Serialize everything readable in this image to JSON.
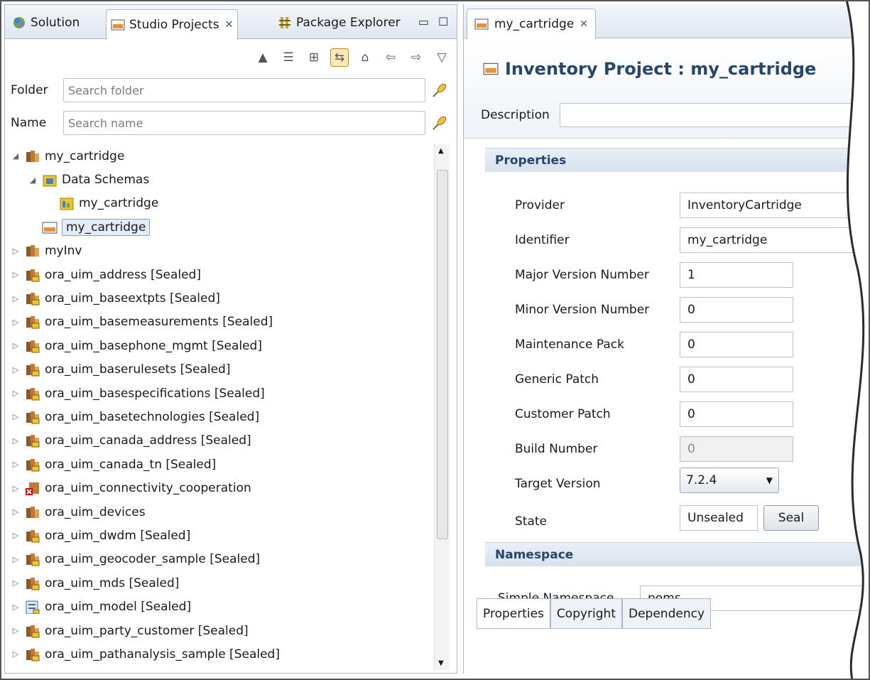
{
  "left_panel": {
    "tabs": [
      {
        "label": "Solution"
      },
      {
        "label": "Studio Projects"
      },
      {
        "label": "Package Explorer"
      }
    ],
    "folder_filter": {
      "label": "Folder",
      "placeholder": "Search folder"
    },
    "name_filter": {
      "label": "Name",
      "placeholder": "Search name"
    },
    "tree": [
      {
        "label": "my_cartridge",
        "level": 0,
        "expanded": true,
        "icon": "cartridge-icon"
      },
      {
        "label": "Data Schemas",
        "level": 1,
        "expanded": true,
        "icon": "data-schemas-folder-icon"
      },
      {
        "label": "my_cartridge",
        "level": 2,
        "icon": "data-schema-icon"
      },
      {
        "label": "my_cartridge",
        "level": 1,
        "icon": "inventory-project-icon",
        "selected": true
      },
      {
        "label": "myInv",
        "level": 0,
        "icon": "cartridge-icon"
      },
      {
        "label": "ora_uim_address [Sealed]",
        "level": 0,
        "icon": "sealed-cartridge-icon"
      },
      {
        "label": "ora_uim_baseextpts [Sealed]",
        "level": 0,
        "icon": "sealed-cartridge-icon"
      },
      {
        "label": "ora_uim_basemeasurements [Sealed]",
        "level": 0,
        "icon": "sealed-cartridge-icon"
      },
      {
        "label": "ora_uim_basephone_mgmt [Sealed]",
        "level": 0,
        "icon": "sealed-cartridge-icon"
      },
      {
        "label": "ora_uim_baserulesets [Sealed]",
        "level": 0,
        "icon": "sealed-cartridge-icon"
      },
      {
        "label": "ora_uim_basespecifications [Sealed]",
        "level": 0,
        "icon": "sealed-cartridge-icon"
      },
      {
        "label": "ora_uim_basetechnologies [Sealed]",
        "level": 0,
        "icon": "sealed-cartridge-icon"
      },
      {
        "label": "ora_uim_canada_address [Sealed]",
        "level": 0,
        "icon": "sealed-cartridge-icon"
      },
      {
        "label": "ora_uim_canada_tn [Sealed]",
        "level": 0,
        "icon": "sealed-cartridge-icon"
      },
      {
        "label": "ora_uim_connectivity_cooperation",
        "level": 0,
        "icon": "error-cartridge-icon"
      },
      {
        "label": "ora_uim_devices",
        "level": 0,
        "icon": "cartridge-icon"
      },
      {
        "label": "ora_uim_dwdm [Sealed]",
        "level": 0,
        "icon": "sealed-cartridge-icon"
      },
      {
        "label": "ora_uim_geocoder_sample [Sealed]",
        "level": 0,
        "icon": "sealed-cartridge-icon"
      },
      {
        "label": "ora_uim_mds [Sealed]",
        "level": 0,
        "icon": "sealed-cartridge-icon"
      },
      {
        "label": "ora_uim_model [Sealed]",
        "level": 0,
        "icon": "model-cartridge-icon"
      },
      {
        "label": "ora_uim_party_customer [Sealed]",
        "level": 0,
        "icon": "sealed-cartridge-icon"
      },
      {
        "label": "ora_uim_pathanalysis_sample [Sealed]",
        "level": 0,
        "icon": "sealed-cartridge-icon"
      }
    ]
  },
  "editor": {
    "tab_label": "my_cartridge",
    "title": "Inventory Project : my_cartridge",
    "description_label": "Description",
    "description_value": "",
    "properties_section": "Properties",
    "properties": {
      "provider": {
        "label": "Provider",
        "value": "InventoryCartridge"
      },
      "identifier": {
        "label": "Identifier",
        "value": "my_cartridge"
      },
      "major_version": {
        "label": "Major Version Number",
        "value": "1"
      },
      "minor_version": {
        "label": "Minor Version Number",
        "value": "0"
      },
      "maintenance_pack": {
        "label": "Maintenance Pack",
        "value": "0"
      },
      "generic_patch": {
        "label": "Generic Patch",
        "value": "0"
      },
      "customer_patch": {
        "label": "Customer Patch",
        "value": "0"
      },
      "build_number": {
        "label": "Build Number",
        "value": "0"
      },
      "target_version": {
        "label": "Target Version",
        "value": "7.2.4"
      },
      "state": {
        "label": "State",
        "value": "Unsealed",
        "button": "Seal"
      }
    },
    "namespace_section": "Namespace",
    "simple_namespace": {
      "label": "Simple Namespace",
      "value": "poms"
    },
    "bottom_tabs": [
      "Properties",
      "Copyright",
      "Dependency"
    ]
  },
  "colors": {
    "accent": "#27466e",
    "selection": "#e3edf9"
  }
}
